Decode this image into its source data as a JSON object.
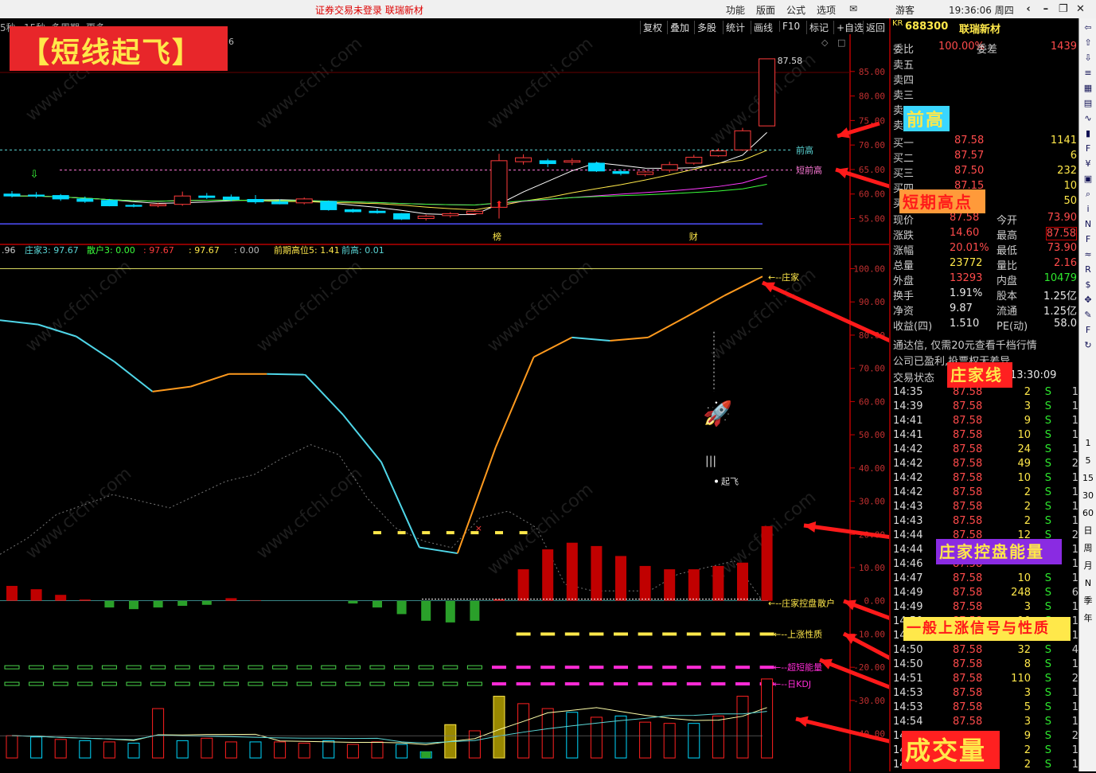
{
  "topbar": {
    "login_status": "证券交易未登录  联瑞新材",
    "menus": [
      "功能",
      "版面",
      "公式",
      "选项"
    ],
    "user": "游客",
    "clock": "19:36:06 周四"
  },
  "subbar": {
    "left_items": [
      "5秒",
      "15秒",
      "多周期",
      "更多"
    ],
    "toolbar": [
      "复权",
      "叠加",
      "多股",
      "统计",
      "画线",
      "F10",
      "标记",
      "+自选",
      "返回"
    ]
  },
  "banner": {
    "title": "【短线起飞】",
    "partial": "6"
  },
  "stock": {
    "code": "688300",
    "name": "联瑞新材",
    "market": "KR"
  },
  "orderbook": {
    "ratio_label": "委比",
    "ratio": "100.00%",
    "diff_label": "委差",
    "diff": "1439",
    "sells": [
      "卖五",
      "卖四",
      "卖三",
      "卖二",
      "卖一"
    ],
    "buys": [
      {
        "label": "买一",
        "price": "87.58",
        "vol": "1141"
      },
      {
        "label": "买二",
        "price": "87.57",
        "vol": "6"
      },
      {
        "label": "买三",
        "price": "87.50",
        "vol": "232"
      },
      {
        "label": "买四",
        "price": "87.15",
        "vol": "10"
      },
      {
        "label": "买五",
        "price": "",
        "vol": "50"
      }
    ]
  },
  "quote": [
    {
      "l1": "现价",
      "v1": "87.58",
      "l2": "今开",
      "v2": "73.90"
    },
    {
      "l1": "涨跌",
      "v1": "14.60",
      "l2": "最高",
      "v2": "87.58"
    },
    {
      "l1": "涨幅",
      "v1": "20.01%",
      "l2": "最低",
      "v2": "73.90"
    },
    {
      "l1": "总量",
      "v1": "23772",
      "l2": "量比",
      "v2": "2.16"
    },
    {
      "l1": "外盘",
      "v1": "13293",
      "l2": "内盘",
      "v2": "10479"
    },
    {
      "l1": "换手",
      "v1": "1.91%",
      "l2": "股本",
      "v2": "1.25亿"
    },
    {
      "l1": "净资",
      "v1": "9.87",
      "l2": "流通",
      "v2": "1.25亿"
    },
    {
      "l1": "收益(四)",
      "v1": "1.510",
      "l2": "PE(动)",
      "v2": "58.0"
    }
  ],
  "notices": [
    "通达信, 仅需20元查看千档行情",
    "公司已盈利,投票权无差异"
  ],
  "trade_status": {
    "label": "交易状态",
    "time": "13:30:09"
  },
  "ticks": [
    {
      "t": "14:35",
      "p": "87.58",
      "v": "2",
      "s": "S",
      "n": "1"
    },
    {
      "t": "14:39",
      "p": "87.58",
      "v": "3",
      "s": "S",
      "n": "1"
    },
    {
      "t": "14:41",
      "p": "87.58",
      "v": "9",
      "s": "S",
      "n": "1"
    },
    {
      "t": "14:41",
      "p": "87.58",
      "v": "10",
      "s": "S",
      "n": "1"
    },
    {
      "t": "14:42",
      "p": "87.58",
      "v": "24",
      "s": "S",
      "n": "1"
    },
    {
      "t": "14:42",
      "p": "87.58",
      "v": "49",
      "s": "S",
      "n": "2"
    },
    {
      "t": "14:42",
      "p": "87.58",
      "v": "10",
      "s": "S",
      "n": "1"
    },
    {
      "t": "14:42",
      "p": "87.58",
      "v": "2",
      "s": "S",
      "n": "1"
    },
    {
      "t": "14:43",
      "p": "87.58",
      "v": "2",
      "s": "S",
      "n": "1"
    },
    {
      "t": "14:43",
      "p": "87.58",
      "v": "2",
      "s": "S",
      "n": "1"
    },
    {
      "t": "14:44",
      "p": "87.58",
      "v": "12",
      "s": "S",
      "n": "2"
    },
    {
      "t": "14:44",
      "p": "87.58",
      "v": "",
      "s": "",
      "n": "1"
    },
    {
      "t": "14:46",
      "p": "87.58",
      "v": "",
      "s": "",
      "n": "1"
    },
    {
      "t": "14:47",
      "p": "87.58",
      "v": "10",
      "s": "S",
      "n": "1"
    },
    {
      "t": "14:49",
      "p": "87.58",
      "v": "248",
      "s": "S",
      "n": "6"
    },
    {
      "t": "14:49",
      "p": "87.58",
      "v": "3",
      "s": "S",
      "n": "1"
    },
    {
      "t": "14:50",
      "p": "87.58",
      "v": "10",
      "s": "S",
      "n": "1"
    },
    {
      "t": "14:50",
      "p": "87.58",
      "v": "",
      "s": "",
      "n": "1"
    },
    {
      "t": "14:50",
      "p": "87.58",
      "v": "32",
      "s": "S",
      "n": "4"
    },
    {
      "t": "14:50",
      "p": "87.58",
      "v": "8",
      "s": "S",
      "n": "1"
    },
    {
      "t": "14:51",
      "p": "87.58",
      "v": "110",
      "s": "S",
      "n": "2"
    },
    {
      "t": "14:53",
      "p": "87.58",
      "v": "3",
      "s": "S",
      "n": "1"
    },
    {
      "t": "14:53",
      "p": "87.58",
      "v": "5",
      "s": "S",
      "n": "1"
    },
    {
      "t": "14:54",
      "p": "87.58",
      "v": "3",
      "s": "S",
      "n": "1"
    },
    {
      "t": "14:54",
      "p": "87.58",
      "v": "9",
      "s": "S",
      "n": "2"
    },
    {
      "t": "14:55",
      "p": "87.58",
      "v": "2",
      "s": "S",
      "n": "1"
    },
    {
      "t": "14:55",
      "p": "87.58",
      "v": "2",
      "s": "S",
      "n": "1"
    }
  ],
  "icons": [
    "back-icon",
    "up-icon",
    "down-icon",
    "list-icon",
    "grid-icon",
    "table-icon",
    "line-icon",
    "kline-icon",
    "fund-icon",
    "money-icon",
    "doc-icon",
    "search-icon",
    "info-icon",
    "news-icon",
    "f10-icon",
    "wave-icon",
    "rsi-icon",
    "dollar-icon",
    "move-icon",
    "pen-icon",
    "fs-icon",
    "refresh-icon"
  ],
  "period_buttons": [
    "1",
    "5",
    "15",
    "30",
    "60",
    "日",
    "周",
    "月",
    "N",
    "季",
    "年"
  ],
  "annotations": {
    "prev_high": "前高",
    "short_high": "短期高点",
    "banker_line": "庄家线",
    "energy": "庄家控盘能量",
    "general_signal": "一般上涨信号与性质",
    "volume": "成交量"
  },
  "watermark": "www.cfchi.com",
  "colors": {
    "up": "#ff3b3b",
    "down": "#00d9ff",
    "banker_rise": "#ff9a1e",
    "banker_fall": "#4fd6e8",
    "energy_bar": "#c00000",
    "yellow": "#ffe84a",
    "magenta": "#ff2bd6",
    "green": "#4ad64a"
  },
  "chart_data": [
    {
      "type": "candlestick",
      "title": "",
      "ylim": [
        52,
        90
      ],
      "yticks": [
        55.0,
        60.0,
        65.0,
        70.0,
        75.0,
        80.0,
        85.0
      ],
      "candles": [
        {
          "o": 60.0,
          "h": 60.6,
          "l": 59.3,
          "c": 59.6
        },
        {
          "o": 59.8,
          "h": 60.4,
          "l": 59.2,
          "c": 59.6
        },
        {
          "o": 59.7,
          "h": 60.0,
          "l": 58.6,
          "c": 59.0
        },
        {
          "o": 59.0,
          "h": 59.5,
          "l": 58.2,
          "c": 58.5
        },
        {
          "o": 58.7,
          "h": 59.0,
          "l": 57.5,
          "c": 57.6
        },
        {
          "o": 57.7,
          "h": 58.0,
          "l": 57.3,
          "c": 57.5
        },
        {
          "o": 57.6,
          "h": 58.2,
          "l": 57.3,
          "c": 57.9
        },
        {
          "o": 57.9,
          "h": 60.5,
          "l": 57.6,
          "c": 59.6
        },
        {
          "o": 59.6,
          "h": 60.2,
          "l": 59.0,
          "c": 59.3
        },
        {
          "o": 59.4,
          "h": 59.9,
          "l": 58.5,
          "c": 58.9
        },
        {
          "o": 58.9,
          "h": 59.8,
          "l": 58.0,
          "c": 58.4
        },
        {
          "o": 58.4,
          "h": 58.9,
          "l": 57.9,
          "c": 58.0
        },
        {
          "o": 58.2,
          "h": 59.3,
          "l": 57.9,
          "c": 59.0
        },
        {
          "o": 58.5,
          "h": 58.7,
          "l": 56.6,
          "c": 56.8
        },
        {
          "o": 56.8,
          "h": 57.0,
          "l": 56.2,
          "c": 56.4
        },
        {
          "o": 56.5,
          "h": 57.0,
          "l": 56.0,
          "c": 56.2
        },
        {
          "o": 56.0,
          "h": 56.1,
          "l": 54.7,
          "c": 54.9
        },
        {
          "o": 55.0,
          "h": 55.8,
          "l": 54.6,
          "c": 55.5
        },
        {
          "o": 55.6,
          "h": 56.3,
          "l": 55.2,
          "c": 56.0
        },
        {
          "o": 56.0,
          "h": 56.8,
          "l": 55.8,
          "c": 56.5
        },
        {
          "o": 57.3,
          "h": 68.2,
          "l": 55.0,
          "c": 66.8
        },
        {
          "o": 66.6,
          "h": 68.1,
          "l": 66.0,
          "c": 67.4
        },
        {
          "o": 66.8,
          "h": 67.2,
          "l": 65.5,
          "c": 66.2
        },
        {
          "o": 66.5,
          "h": 67.3,
          "l": 65.9,
          "c": 66.8
        },
        {
          "o": 66.3,
          "h": 66.6,
          "l": 64.5,
          "c": 64.7
        },
        {
          "o": 64.6,
          "h": 65.0,
          "l": 63.8,
          "c": 64.2
        },
        {
          "o": 64.0,
          "h": 64.8,
          "l": 63.6,
          "c": 64.5
        },
        {
          "o": 64.9,
          "h": 66.6,
          "l": 64.4,
          "c": 66.0
        },
        {
          "o": 66.3,
          "h": 68.0,
          "l": 66.0,
          "c": 67.5
        },
        {
          "o": 67.8,
          "h": 69.3,
          "l": 67.6,
          "c": 68.8
        },
        {
          "o": 69.0,
          "h": 73.5,
          "l": 68.8,
          "c": 72.9
        },
        {
          "o": 73.9,
          "h": 87.58,
          "l": 73.9,
          "c": 87.58
        }
      ],
      "price_labels": {
        "high": "87.58"
      },
      "levels": [
        {
          "name": "前高",
          "value": 69.0
        },
        {
          "name": "短前高",
          "value": 64.9
        }
      ],
      "markers": [
        "榜",
        "财"
      ]
    },
    {
      "type": "indicator",
      "legend": [
        {
          "name": "",
          "value": ".96"
        },
        {
          "name": "庄家3",
          "value": "97.67"
        },
        {
          "name": "散户3",
          "value": "0.00"
        },
        {
          "name": "",
          "value": "97.67"
        },
        {
          "name": "",
          "value": "97.67"
        },
        {
          "name": "",
          "value": "0.00"
        },
        {
          "name": "前期高位5",
          "value": "1.41"
        },
        {
          "name": "前高",
          "value": "0.01"
        }
      ],
      "ylim": [
        -48,
        103
      ],
      "yticks": [
        100.0,
        90.0,
        80.0,
        70.0,
        60.0,
        50.0,
        40.0,
        30.0,
        20.0,
        10.0,
        0.0,
        -10.0,
        -20.0,
        -30.0,
        -40.0
      ],
      "banker": [
        84.5,
        83.2,
        79.6,
        72.0,
        63.0,
        64.5,
        68.3,
        68.3,
        68.1,
        56.0,
        41.8,
        16.1,
        14.3,
        46.2,
        73.4,
        79.3,
        78.3,
        79.3,
        85.5,
        91.9,
        97.67
      ],
      "retail": [
        14.0,
        19.0,
        26.0,
        29.0,
        32.0,
        30.0,
        28.0,
        32.0,
        36.0,
        38.0,
        43.0,
        47.0,
        44.0,
        31.0,
        22.0,
        18.0,
        16.0,
        25.0,
        27.0,
        22.0,
        5.0,
        3.0,
        3.0,
        3.0,
        8.0,
        10.0,
        12.0,
        0.0
      ],
      "energy": [
        4.5,
        3.5,
        1.8,
        0.4,
        0.0,
        0.0,
        0.0,
        0.0,
        0.0,
        0.8,
        0.2,
        0.0,
        0.0,
        0.0,
        0.0,
        0.0,
        0.0,
        0.0,
        0.0,
        0.0,
        0.5,
        9.5,
        15.5,
        17.5,
        16.5,
        13.5,
        10.5,
        9.5,
        9.5,
        10.5,
        11.5,
        22.5
      ],
      "retail_bars": [
        0,
        0,
        0,
        0,
        -2.0,
        -2.5,
        -2.0,
        -1.5,
        -1.2,
        0,
        0,
        0,
        0,
        0,
        -0.8,
        -2.0,
        -4.0,
        -6.0,
        -6.5,
        -6.0,
        0,
        0,
        0,
        0,
        0,
        0,
        0,
        0,
        0,
        0,
        0,
        0
      ],
      "small_markers": [
        0,
        0,
        0,
        0,
        0,
        0,
        0,
        0,
        0,
        0,
        0,
        0,
        0,
        0,
        0,
        1,
        1,
        1,
        1,
        1,
        1,
        1,
        0,
        0,
        0,
        0,
        0,
        0,
        0,
        0,
        0,
        0
      ],
      "series_labels": [
        "庄家",
        "庄家控盘",
        "散户",
        "上涨性质",
        "超短能量",
        "日KDJ"
      ],
      "signals": {
        "rise_nature": [
          0,
          0,
          0,
          0,
          0,
          0,
          0,
          0,
          0,
          0,
          0,
          0,
          0,
          0,
          0,
          0,
          0,
          0,
          0,
          0,
          0,
          1,
          1,
          1,
          1,
          1,
          1,
          1,
          1,
          1,
          1,
          1
        ],
        "short_energy": [
          2,
          2,
          2,
          2,
          2,
          2,
          2,
          2,
          2,
          2,
          2,
          2,
          2,
          2,
          2,
          2,
          2,
          2,
          2,
          2,
          1,
          1,
          1,
          1,
          1,
          1,
          1,
          1,
          1,
          1,
          1,
          1
        ],
        "day_kdj": [
          2,
          2,
          2,
          2,
          2,
          2,
          2,
          2,
          2,
          2,
          2,
          2,
          2,
          2,
          2,
          2,
          2,
          2,
          2,
          2,
          1,
          1,
          1,
          1,
          1,
          1,
          1,
          1,
          1,
          1,
          1,
          1
        ]
      },
      "takeoff_label": "起飞",
      "volume": [
        1.8,
        1.7,
        1.5,
        1.4,
        1.3,
        1.2,
        4.0,
        1.4,
        1.6,
        1.3,
        1.3,
        1.3,
        1.2,
        1.4,
        1.1,
        1.3,
        1.1,
        0.5,
        2.7,
        2.2,
        5.0,
        4.4,
        4.0,
        3.7,
        3.3,
        3.4,
        2.9,
        2.8,
        2.8,
        3.4,
        5.0,
        6.4
      ],
      "volume_up": [
        1,
        0,
        1,
        0,
        1,
        0,
        1,
        0,
        1,
        1,
        0,
        1,
        1,
        0,
        1,
        1,
        0,
        0,
        0,
        1,
        1,
        1,
        1,
        0,
        1,
        0,
        1,
        1,
        0,
        1,
        1,
        1
      ]
    }
  ]
}
